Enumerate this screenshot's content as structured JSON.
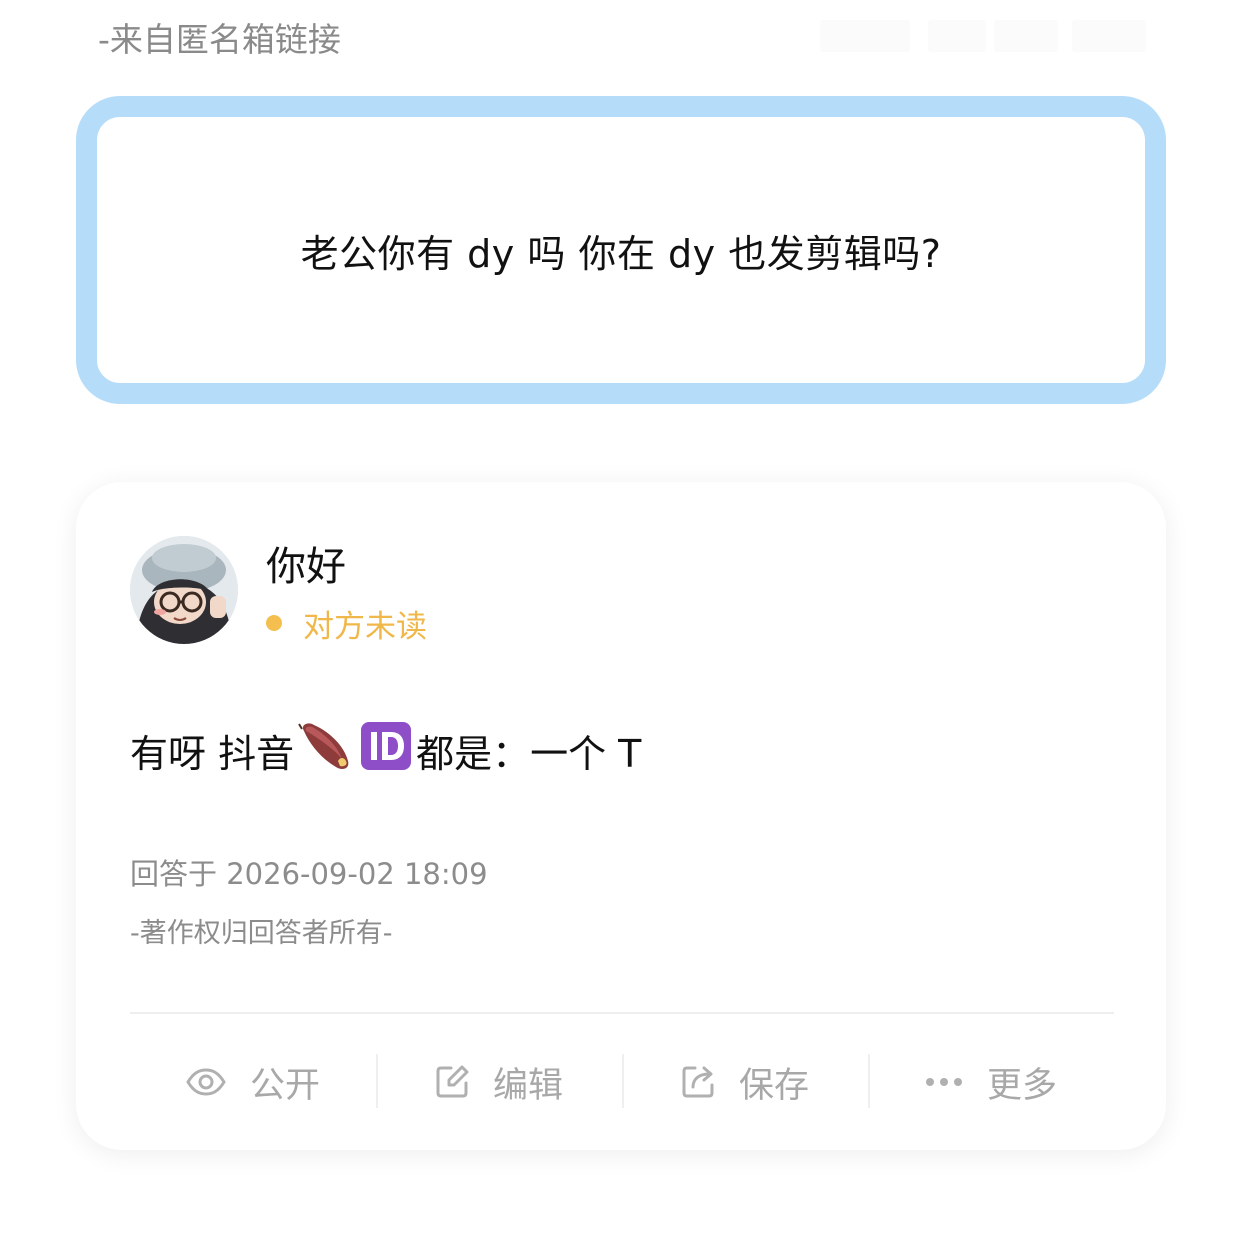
{
  "source_label": "-来自匿名箱链接",
  "question": {
    "text": "老公你有 dy 吗 你在 dy 也发剪辑吗?"
  },
  "answer": {
    "user_name": "你好",
    "read_status": "对方未读",
    "text_before": "有呀 抖音",
    "emoji_icons": [
      "sweet-potato-icon",
      "id-icon"
    ],
    "text_after": "都是：一个 T",
    "time": "回答于 2026-09-02 18:09",
    "copyright": "-著作权归回答者所有-"
  },
  "actions": [
    {
      "label": "公开",
      "icon": "eye-icon"
    },
    {
      "label": "编辑",
      "icon": "edit-icon"
    },
    {
      "label": "保存",
      "icon": "share-icon"
    },
    {
      "label": "更多",
      "icon": "more-dots-icon"
    }
  ],
  "colors": {
    "question_border": "#b5dcf9",
    "status_accent": "#f4bf4f",
    "muted_text": "#8c8c8c",
    "action_text": "#a8a8a8"
  }
}
